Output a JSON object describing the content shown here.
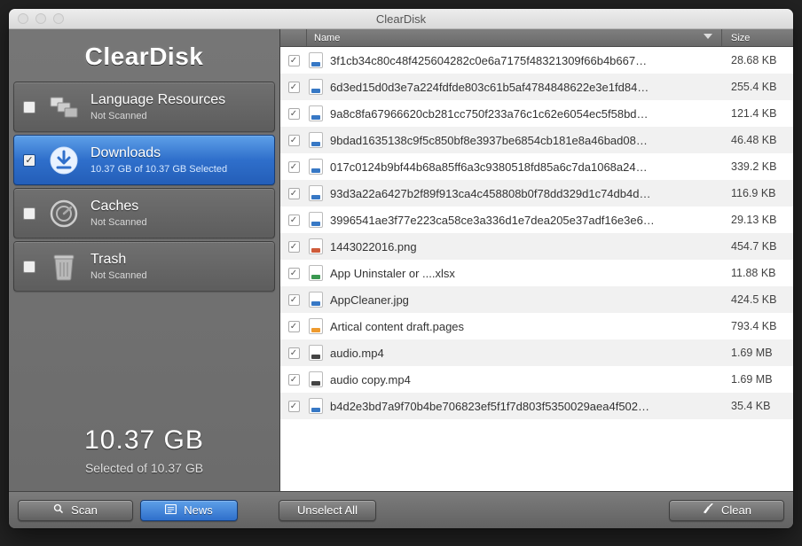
{
  "window": {
    "title": "ClearDisk"
  },
  "app_name": "ClearDisk",
  "categories": [
    {
      "id": "language-resources",
      "title": "Language Resources",
      "subtitle": "Not Scanned",
      "checked": false,
      "selected": false,
      "icon": "flags-icon"
    },
    {
      "id": "downloads",
      "title": "Downloads",
      "subtitle": "10.37 GB of 10.37 GB Selected",
      "checked": true,
      "selected": true,
      "icon": "download-icon"
    },
    {
      "id": "caches",
      "title": "Caches",
      "subtitle": "Not Scanned",
      "checked": false,
      "selected": false,
      "icon": "gauge-icon"
    },
    {
      "id": "trash",
      "title": "Trash",
      "subtitle": "Not Scanned",
      "checked": false,
      "selected": false,
      "icon": "trash-icon"
    }
  ],
  "summary": {
    "big": "10.37 GB",
    "sub": "Selected of 10.37 GB"
  },
  "columns": {
    "name": "Name",
    "size": "Size"
  },
  "files": [
    {
      "name": "3f1cb34c80c48f425604282c0e6a7175f48321309f66b4b667…",
      "size": "28.68 KB",
      "checked": true,
      "type": "jpeg"
    },
    {
      "name": "6d3ed15d0d3e7a224fdfde803c61b5af4784848622e3e1fd84…",
      "size": "255.4 KB",
      "checked": true,
      "type": "jpeg"
    },
    {
      "name": "9a8c8fa67966620cb281cc750f233a76c1c62e6054ec5f58bd…",
      "size": "121.4 KB",
      "checked": true,
      "type": "jpeg"
    },
    {
      "name": "9bdad1635138c9f5c850bf8e3937be6854cb181e8a46bad08…",
      "size": "46.48 KB",
      "checked": true,
      "type": "jpeg"
    },
    {
      "name": "017c0124b9bf44b68a85ff6a3c9380518fd85a6c7da1068a24…",
      "size": "339.2 KB",
      "checked": true,
      "type": "jpeg"
    },
    {
      "name": "93d3a22a6427b2f89f913ca4c458808b0f78dd329d1c74db4d…",
      "size": "116.9 KB",
      "checked": true,
      "type": "jpeg"
    },
    {
      "name": "3996541ae3f77e223ca58ce3a336d1e7dea205e37adf16e3e6…",
      "size": "29.13 KB",
      "checked": true,
      "type": "jpeg"
    },
    {
      "name": "1443022016.png",
      "size": "454.7 KB",
      "checked": true,
      "type": "png"
    },
    {
      "name": "App Uninstaler or ....xlsx",
      "size": "11.88 KB",
      "checked": true,
      "type": "xlsx"
    },
    {
      "name": "AppCleaner.jpg",
      "size": "424.5 KB",
      "checked": true,
      "type": "jpg"
    },
    {
      "name": "Artical content draft.pages",
      "size": "793.4 KB",
      "checked": true,
      "type": "pages"
    },
    {
      "name": "audio.mp4",
      "size": "1.69 MB",
      "checked": true,
      "type": "mp4"
    },
    {
      "name": "audio copy.mp4",
      "size": "1.69 MB",
      "checked": true,
      "type": "mp4"
    },
    {
      "name": "b4d2e3bd7a9f70b4be706823ef5f1f7d803f5350029aea4f502…",
      "size": "35.4 KB",
      "checked": true,
      "type": "jpeg"
    }
  ],
  "toolbar": {
    "scan": "Scan",
    "news": "News",
    "unselect_all": "Unselect All",
    "clean": "Clean"
  }
}
